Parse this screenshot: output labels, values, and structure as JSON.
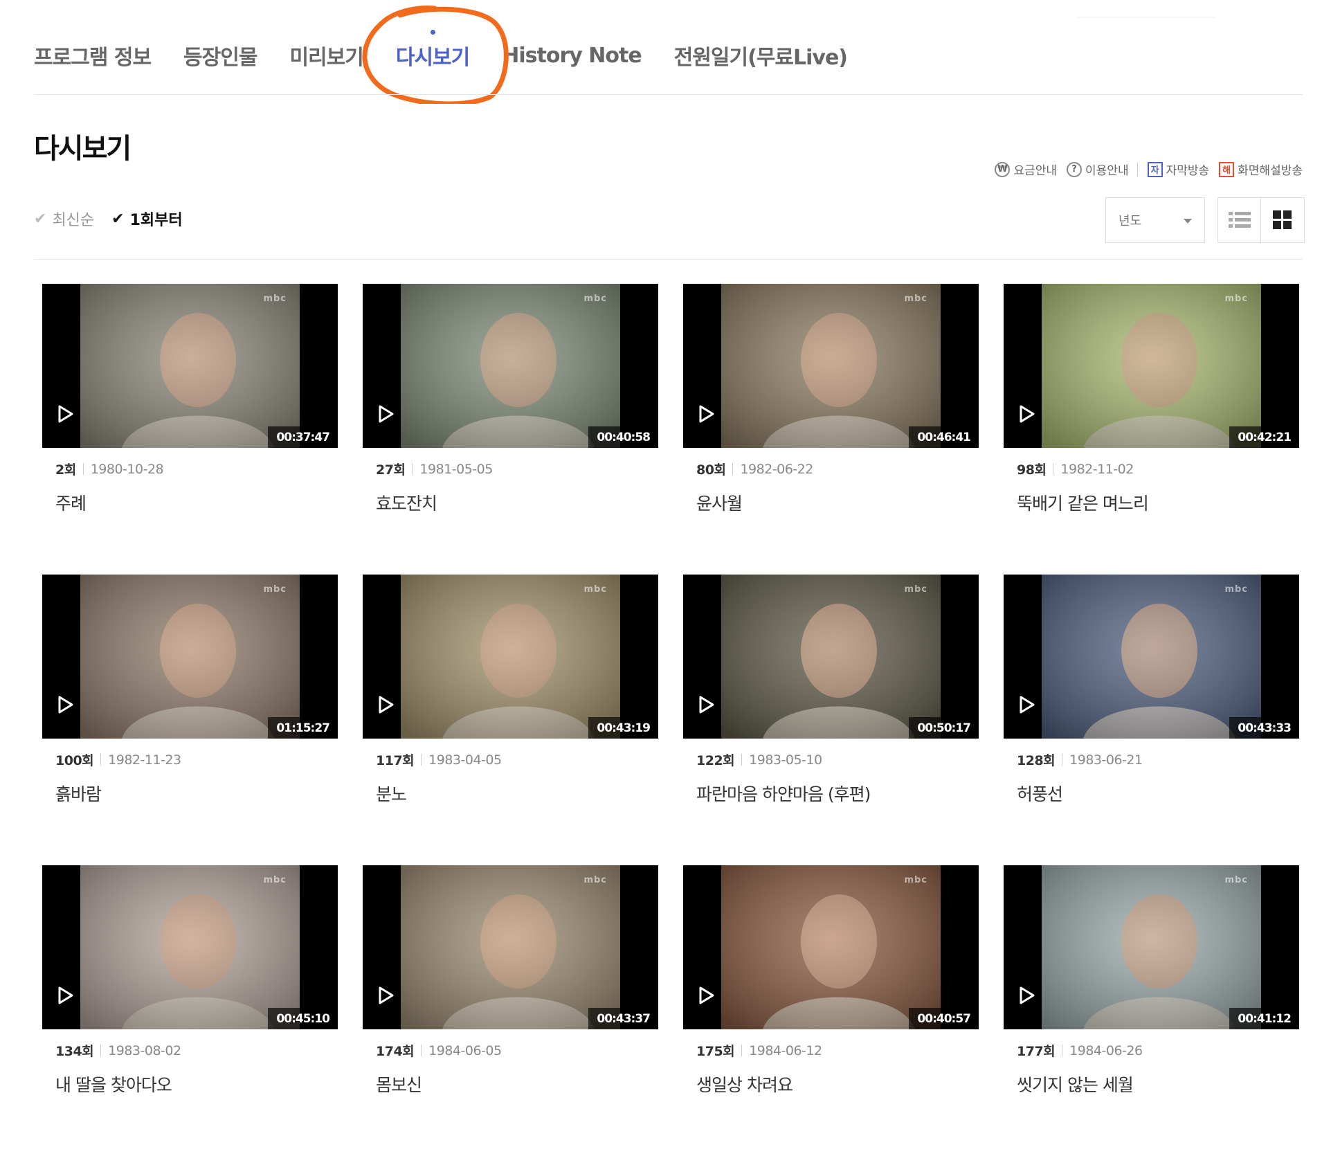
{
  "tabs": [
    {
      "label": "프로그램 정보",
      "active": false
    },
    {
      "label": "등장인물",
      "active": false
    },
    {
      "label": "미리보기",
      "active": false
    },
    {
      "label": "다시보기",
      "active": true
    },
    {
      "label": "History Note",
      "active": false
    },
    {
      "label": "전원일기(무료Live)",
      "active": false
    }
  ],
  "page_title": "다시보기",
  "guide": {
    "fee": "요금안내",
    "fee_icon_glyph": "₩",
    "usage": "이용안내",
    "usage_icon_glyph": "?",
    "subtitle": "자막방송",
    "subtitle_icon_glyph": "자",
    "audio_desc": "화면해설방송",
    "audio_desc_icon_glyph": "해"
  },
  "sort": {
    "latest": "최신순",
    "first": "1회부터",
    "selected": "1회부터"
  },
  "year_select": "년도",
  "colors": {
    "accent": "#4c62c8",
    "annotation": "#f26a1b",
    "audio_desc": "#ef4c2d"
  },
  "episodes": [
    {
      "ep": "2회",
      "date": "1980-10-28",
      "title": "주례",
      "duration": "00:37:47",
      "channel": "mbc",
      "thumb_color": "#8a8578"
    },
    {
      "ep": "27회",
      "date": "1981-05-05",
      "title": "효도잔치",
      "duration": "00:40:58",
      "channel": "mbc",
      "thumb_color": "#7e8a78"
    },
    {
      "ep": "80회",
      "date": "1982-06-22",
      "title": "윤사월",
      "duration": "00:46:41",
      "channel": "mbc",
      "thumb_color": "#8a7a60"
    },
    {
      "ep": "98회",
      "date": "1982-11-02",
      "title": "뚝배기 같은 며느리",
      "duration": "00:42:21",
      "channel": "mbc",
      "thumb_color": "#a8b870"
    },
    {
      "ep": "100회",
      "date": "1982-11-23",
      "title": "흙바람",
      "duration": "01:15:27",
      "channel": "mbc",
      "thumb_color": "#8f7a6a"
    },
    {
      "ep": "117회",
      "date": "1983-04-05",
      "title": "분노",
      "duration": "00:43:19",
      "channel": "mbc",
      "thumb_color": "#a0906a"
    },
    {
      "ep": "122회",
      "date": "1983-05-10",
      "title": "파란마음 하얀마음 (후편)",
      "duration": "00:50:17",
      "channel": "mbc",
      "thumb_color": "#5f5a48"
    },
    {
      "ep": "128회",
      "date": "1983-06-21",
      "title": "허풍선",
      "duration": "00:43:33",
      "channel": "mbc",
      "thumb_color": "#506080"
    },
    {
      "ep": "134회",
      "date": "1983-08-02",
      "title": "내 딸을 찾아다오",
      "duration": "00:45:10",
      "channel": "mbc",
      "thumb_color": "#b0a098"
    },
    {
      "ep": "174회",
      "date": "1984-06-05",
      "title": "몸보신",
      "duration": "00:43:37",
      "channel": "mbc",
      "thumb_color": "#9a8a70"
    },
    {
      "ep": "175회",
      "date": "1984-06-12",
      "title": "생일상 차려요",
      "duration": "00:40:57",
      "channel": "mbc",
      "thumb_color": "#8a5a40"
    },
    {
      "ep": "177회",
      "date": "1984-06-26",
      "title": "씻기지 않는 세월",
      "duration": "00:41:12",
      "channel": "mbc",
      "thumb_color": "#9aa8a8"
    }
  ]
}
